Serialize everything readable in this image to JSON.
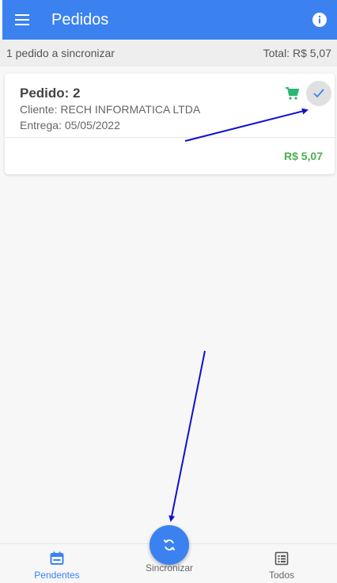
{
  "app_bar": {
    "title": "Pedidos",
    "menu_icon": "menu-icon",
    "info_icon": "info-icon"
  },
  "subheader": {
    "pending_text": "1 pedido a sincronizar",
    "total_text": "Total: R$ 5,07"
  },
  "orders": [
    {
      "title": "Pedido: 2",
      "client": "Cliente: RECH INFORMATICA LTDA",
      "delivery": "Entrega: 05/05/2022",
      "total": "R$ 5,07",
      "cart_icon": "cart-icon",
      "check_icon": "check-icon"
    }
  ],
  "bottom_nav": {
    "items": [
      {
        "label": "Pendentes",
        "icon": "calendar-icon",
        "active": true
      },
      {
        "label": "Sincronizar",
        "icon": "sync-icon",
        "active": false
      },
      {
        "label": "Todos",
        "icon": "list-icon",
        "active": false
      }
    ]
  },
  "colors": {
    "primary": "#3b82f0",
    "success": "#4caf50",
    "annotation_arrow": "#1010d0"
  }
}
